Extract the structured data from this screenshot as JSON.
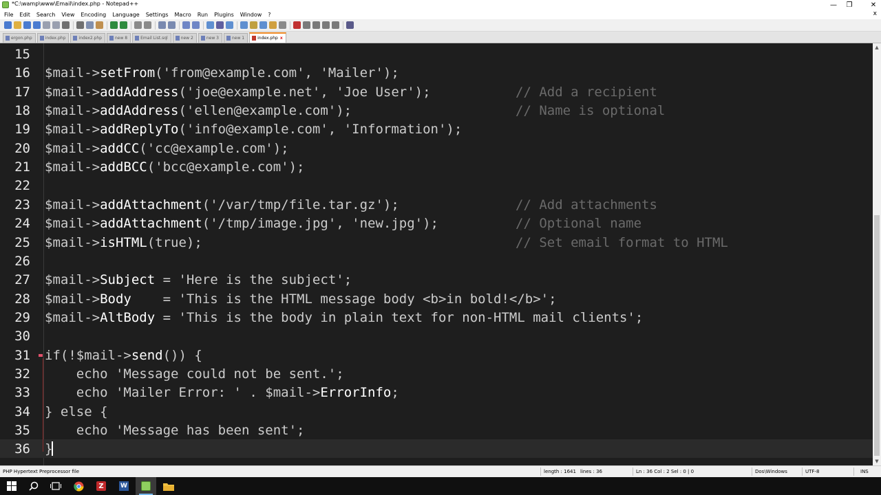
{
  "window": {
    "title": "*C:\\wamp\\www\\Email\\index.php - Notepad++",
    "minimize_glyph": "—",
    "maximize_glyph": "❐",
    "close_glyph": "✕"
  },
  "menu": {
    "items": [
      "File",
      "Edit",
      "Search",
      "View",
      "Encoding",
      "Language",
      "Settings",
      "Macro",
      "Run",
      "Plugins",
      "Window",
      "?"
    ],
    "close_glyph": "x"
  },
  "toolbar": {
    "groups": [
      [
        {
          "icon": "new-file-icon",
          "color": "#4a7bd0"
        },
        {
          "icon": "open-file-icon",
          "color": "#e0b040"
        },
        {
          "icon": "save-icon",
          "color": "#4a7bd0"
        },
        {
          "icon": "save-all-icon",
          "color": "#4a7bd0"
        },
        {
          "icon": "close-file-icon",
          "color": "#9aa0b0"
        },
        {
          "icon": "close-all-icon",
          "color": "#9aa0b0"
        },
        {
          "icon": "print-icon",
          "color": "#707070"
        }
      ],
      [
        {
          "icon": "cut-icon",
          "color": "#707070"
        },
        {
          "icon": "copy-icon",
          "color": "#8090b0"
        },
        {
          "icon": "paste-icon",
          "color": "#c09050"
        }
      ],
      [
        {
          "icon": "undo-icon",
          "color": "#2e8b3e"
        },
        {
          "icon": "redo-icon",
          "color": "#2e8b3e"
        }
      ],
      [
        {
          "icon": "find-icon",
          "color": "#8a8a8a"
        },
        {
          "icon": "replace-icon",
          "color": "#8a8a8a"
        }
      ],
      [
        {
          "icon": "zoom-in-icon",
          "color": "#7a8ab0"
        },
        {
          "icon": "zoom-out-icon",
          "color": "#7a8ab0"
        }
      ],
      [
        {
          "icon": "sync-vertical-icon",
          "color": "#6f86c6"
        },
        {
          "icon": "sync-horizontal-icon",
          "color": "#6f86c6"
        }
      ],
      [
        {
          "icon": "word-wrap-icon",
          "color": "#5f8fd0"
        },
        {
          "icon": "show-all-chars-icon",
          "color": "#5f5f9f"
        },
        {
          "icon": "indent-guide-icon",
          "color": "#5f8fd0"
        }
      ],
      [
        {
          "icon": "lang-define-icon",
          "color": "#5f8fd0"
        },
        {
          "icon": "doc-map-icon",
          "color": "#c0a040"
        },
        {
          "icon": "function-list-icon",
          "color": "#5f8fd0"
        },
        {
          "icon": "folder-workspace-icon",
          "color": "#d0a040"
        },
        {
          "icon": "monitoring-icon",
          "color": "#8a8a8a"
        }
      ],
      [
        {
          "icon": "macro-record-icon",
          "color": "#c03030"
        },
        {
          "icon": "macro-stop-icon",
          "color": "#7a7a7a"
        },
        {
          "icon": "macro-play-icon",
          "color": "#7a7a7a"
        },
        {
          "icon": "macro-play-multiple-icon",
          "color": "#7a7a7a"
        },
        {
          "icon": "macro-save-icon",
          "color": "#7a7a7a"
        }
      ],
      [
        {
          "icon": "spell-check-icon",
          "color": "#5a5a8a"
        }
      ]
    ]
  },
  "tabs": [
    {
      "label": "ergon.php",
      "active": false
    },
    {
      "label": "index.php",
      "active": false
    },
    {
      "label": "index2.php",
      "active": false
    },
    {
      "label": "new 8",
      "active": false
    },
    {
      "label": "Email List.sql",
      "active": false
    },
    {
      "label": "new 2",
      "active": false
    },
    {
      "label": "new 3",
      "active": false
    },
    {
      "label": "new 1",
      "active": false
    },
    {
      "label": "index.php",
      "active": true
    }
  ],
  "editor": {
    "lines": [
      {
        "n": "15",
        "parts": []
      },
      {
        "n": "16",
        "parts": [
          {
            "t": "$mail->",
            "c": "#cccccc"
          },
          {
            "t": "setFrom",
            "c": "#ffffff"
          },
          {
            "t": "(",
            "c": "#cccccc"
          },
          {
            "t": "'from@example.com'",
            "c": "#cccccc"
          },
          {
            "t": ", ",
            "c": "#cccccc"
          },
          {
            "t": "'Mailer'",
            "c": "#cccccc"
          },
          {
            "t": ");",
            "c": "#cccccc"
          }
        ]
      },
      {
        "n": "17",
        "parts": [
          {
            "t": "$mail->",
            "c": "#cccccc"
          },
          {
            "t": "addAddress",
            "c": "#ffffff"
          },
          {
            "t": "('joe@example.net', 'Joe User');",
            "c": "#cccccc"
          }
        ],
        "comment": "// Add a recipient"
      },
      {
        "n": "18",
        "parts": [
          {
            "t": "$mail->",
            "c": "#cccccc"
          },
          {
            "t": "addAddress",
            "c": "#ffffff"
          },
          {
            "t": "('ellen@example.com');",
            "c": "#cccccc"
          }
        ],
        "comment": "// Name is optional"
      },
      {
        "n": "19",
        "parts": [
          {
            "t": "$mail->",
            "c": "#cccccc"
          },
          {
            "t": "addReplyTo",
            "c": "#ffffff"
          },
          {
            "t": "('info@example.com', 'Information');",
            "c": "#cccccc"
          }
        ]
      },
      {
        "n": "20",
        "parts": [
          {
            "t": "$mail->",
            "c": "#cccccc"
          },
          {
            "t": "addCC",
            "c": "#ffffff"
          },
          {
            "t": "('cc@example.com');",
            "c": "#cccccc"
          }
        ]
      },
      {
        "n": "21",
        "parts": [
          {
            "t": "$mail->",
            "c": "#cccccc"
          },
          {
            "t": "addBCC",
            "c": "#ffffff"
          },
          {
            "t": "('bcc@example.com');",
            "c": "#cccccc"
          }
        ]
      },
      {
        "n": "22",
        "parts": []
      },
      {
        "n": "23",
        "parts": [
          {
            "t": "$mail->",
            "c": "#cccccc"
          },
          {
            "t": "addAttachment",
            "c": "#ffffff"
          },
          {
            "t": "('/var/tmp/file.tar.gz');",
            "c": "#cccccc"
          }
        ],
        "comment": "// Add attachments"
      },
      {
        "n": "24",
        "parts": [
          {
            "t": "$mail->",
            "c": "#cccccc"
          },
          {
            "t": "addAttachment",
            "c": "#ffffff"
          },
          {
            "t": "('/tmp/image.jpg', 'new.jpg');",
            "c": "#cccccc"
          }
        ],
        "comment": "// Optional name"
      },
      {
        "n": "25",
        "parts": [
          {
            "t": "$mail->",
            "c": "#cccccc"
          },
          {
            "t": "isHTML",
            "c": "#ffffff"
          },
          {
            "t": "(true);",
            "c": "#cccccc"
          }
        ],
        "comment": "// Set email format to HTML"
      },
      {
        "n": "26",
        "parts": []
      },
      {
        "n": "27",
        "parts": [
          {
            "t": "$mail->",
            "c": "#cccccc"
          },
          {
            "t": "Subject",
            "c": "#ffffff"
          },
          {
            "t": " = 'Here is the subject';",
            "c": "#cccccc"
          }
        ]
      },
      {
        "n": "28",
        "parts": [
          {
            "t": "$mail->",
            "c": "#cccccc"
          },
          {
            "t": "Body",
            "c": "#ffffff"
          },
          {
            "t": "    = 'This is the HTML message body <b>in bold!</b>';",
            "c": "#cccccc"
          }
        ]
      },
      {
        "n": "29",
        "parts": [
          {
            "t": "$mail->",
            "c": "#cccccc"
          },
          {
            "t": "AltBody",
            "c": "#ffffff"
          },
          {
            "t": " = 'This is the body in plain text for non-HTML mail clients';",
            "c": "#cccccc"
          }
        ]
      },
      {
        "n": "30",
        "parts": []
      },
      {
        "n": "31",
        "parts": [
          {
            "t": "if(!",
            "c": "#cccccc"
          },
          {
            "t": "$mail->",
            "c": "#cccccc"
          },
          {
            "t": "send",
            "c": "#ffffff"
          },
          {
            "t": "()) {",
            "c": "#cccccc"
          }
        ],
        "fold": true
      },
      {
        "n": "32",
        "parts": [
          {
            "t": "    echo 'Message could not be sent.';",
            "c": "#cccccc"
          }
        ]
      },
      {
        "n": "33",
        "parts": [
          {
            "t": "    echo 'Mailer Error: ' . ",
            "c": "#cccccc"
          },
          {
            "t": "$mail->",
            "c": "#cccccc"
          },
          {
            "t": "ErrorInfo",
            "c": "#ffffff"
          },
          {
            "t": ";",
            "c": "#cccccc"
          }
        ]
      },
      {
        "n": "34",
        "parts": [
          {
            "t": "} else {",
            "c": "#cccccc"
          }
        ]
      },
      {
        "n": "35",
        "parts": [
          {
            "t": "    echo 'Message has been sent';",
            "c": "#cccccc"
          }
        ]
      },
      {
        "n": "36",
        "parts": [
          {
            "t": "}",
            "c": "#cccccc"
          }
        ],
        "current": true
      }
    ]
  },
  "scrollbar": {
    "up_glyph": "▲",
    "down_glyph": "▼"
  },
  "status": {
    "filetype": "PHP Hypertext Preprocessor file",
    "length": "length : 1641",
    "lines": "lines : 36",
    "position": "Ln : 36   Col : 2   Sel : 0 | 0",
    "eol": "Dos\\Windows",
    "encoding": "UTF-8",
    "mode": "INS"
  },
  "taskbar": {
    "items": [
      {
        "name": "start-button",
        "icon": "windows-start-icon",
        "color": "#ffffff",
        "active": false
      },
      {
        "name": "search-button",
        "icon": "search-icon",
        "color": "#ffffff",
        "active": false
      },
      {
        "name": "task-view-button",
        "icon": "task-view-icon",
        "color": "#ffffff",
        "active": false
      },
      {
        "name": "chrome-button",
        "icon": "chrome-icon",
        "color": "#e0473b",
        "active": false
      },
      {
        "name": "filezilla-button",
        "icon": "filezilla-icon",
        "color": "#c0282a",
        "active": false
      },
      {
        "name": "word-button",
        "icon": "word-icon",
        "color": "#2b579a",
        "active": false
      },
      {
        "name": "notepadpp-button",
        "icon": "notepadpp-icon",
        "color": "#8fcf5f",
        "active": true
      },
      {
        "name": "file-explorer-button",
        "icon": "folder-icon",
        "color": "#f0c040",
        "active": false
      }
    ]
  },
  "colors": {
    "editor_bg": "#1e1e1e",
    "line_number": "#e8e8e8",
    "default_text": "#dcdcdc",
    "comment": "#6a6a6a",
    "current_line": "#2b2b2b",
    "active_tab_accent": "#f08a24"
  }
}
